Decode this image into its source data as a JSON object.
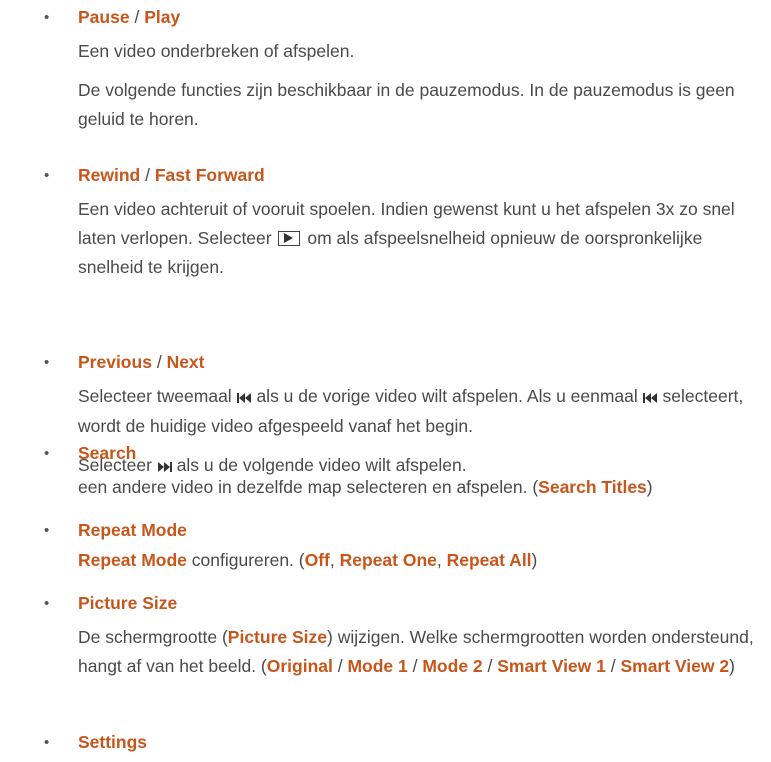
{
  "items": [
    {
      "title_a": "Pause",
      "sep": "/",
      "title_b": "Play",
      "line1": "Een video onderbreken of afspelen.",
      "line2": "De volgende functies zijn beschikbaar in de pauzemodus. In de pauzemodus is geen geluid te horen."
    },
    {
      "title_a": "Rewind",
      "sep": "/",
      "title_b": "Fast Forward",
      "line1_a": "Een video achteruit of vooruit spoelen. Indien gewenst kunt u het afspelen 3x zo snel laten verlopen. Selecteer",
      "line1_b": "om als afspeelsnelheid opnieuw de oorspronkelijke snelheid te krijgen.",
      "icon": "play-box-icon"
    },
    {
      "title_a": "Previous",
      "sep": "/",
      "title_b": "Next",
      "line1_a": "Selecteer tweemaal",
      "line1_b": "als u de vorige video wilt afspelen. Als u eenmaal",
      "line1_c": "selecteert, wordt de huidige video afgespeeld vanaf het begin.",
      "line2_a": "Selecteer",
      "line2_b": "als u de volgende video wilt afspelen.",
      "icons": [
        "previous-icon",
        "next-icon"
      ]
    },
    {
      "title": "Search",
      "line1_a": "een andere video in dezelfde map selecteren en afspelen. (",
      "line1_link": "Search Titles",
      "line1_b": ")"
    },
    {
      "title": "Repeat Mode",
      "line1_link": "Repeat Mode",
      "line1_a": " configureren. (",
      "opt1": "Off",
      "c1": ", ",
      "opt2": "Repeat One",
      "c2": ", ",
      "opt3": "Repeat All",
      "line1_b": ")"
    },
    {
      "title": "Picture Size",
      "line1_a": "De schermgrootte (",
      "line1_link": "Picture Size",
      "line1_b": ") wijzigen. Welke schermgrootten worden ondersteund, hangt af van het beeld. (",
      "opt1": "Original",
      "s1": " / ",
      "opt2": "Mode 1",
      "s2": " / ",
      "opt3": "Mode 2",
      "s3": " / ",
      "opt4": "Smart View 1",
      "s4": " / ",
      "opt5": "Smart View 2",
      "line1_c": ")"
    },
    {
      "title": "Settings"
    }
  ],
  "bullet": "•",
  "colors": {
    "accent": "#c8561b",
    "text": "#4a4a4a"
  }
}
